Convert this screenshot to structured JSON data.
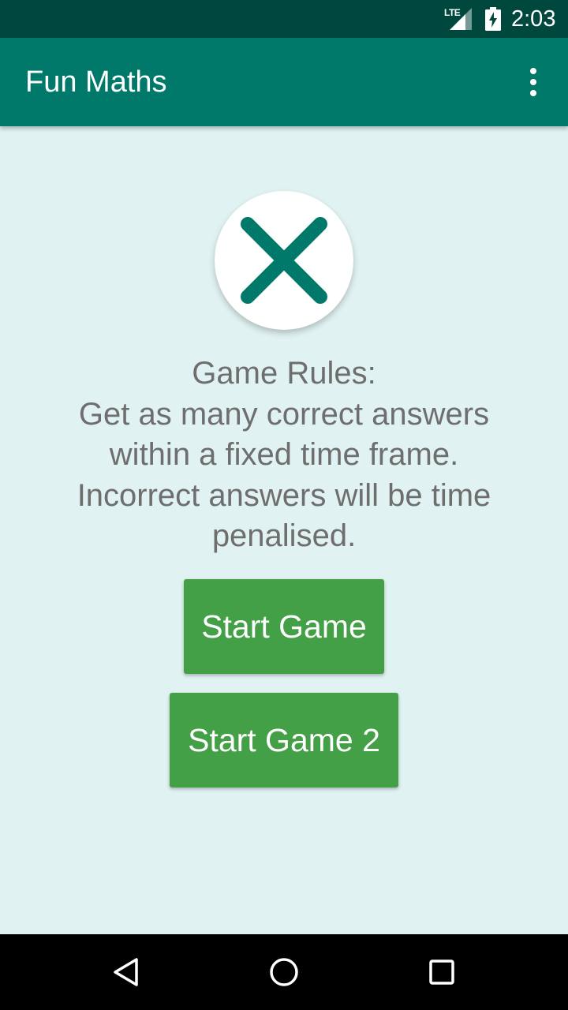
{
  "status_bar": {
    "network": "LTE",
    "time": "2:03"
  },
  "app_bar": {
    "title": "Fun Maths",
    "menu_icon": "more-vert-icon"
  },
  "result_icon": {
    "name": "close-x-icon",
    "color": "#00796b"
  },
  "rules": {
    "lines": [
      "Game Rules:",
      "Get as many correct answers",
      "within a fixed time frame.",
      "Incorrect answers will be time",
      "penalised."
    ]
  },
  "buttons": {
    "start_game": "Start Game",
    "start_game_2": "Start Game 2"
  },
  "colors": {
    "status_bar": "#00483e",
    "app_bar": "#00796b",
    "background": "#e0f2f1",
    "button": "#43a047",
    "rules_text": "#6e6e6e"
  },
  "nav_bar": {
    "icons": [
      "back-icon",
      "home-icon",
      "recents-icon"
    ]
  }
}
